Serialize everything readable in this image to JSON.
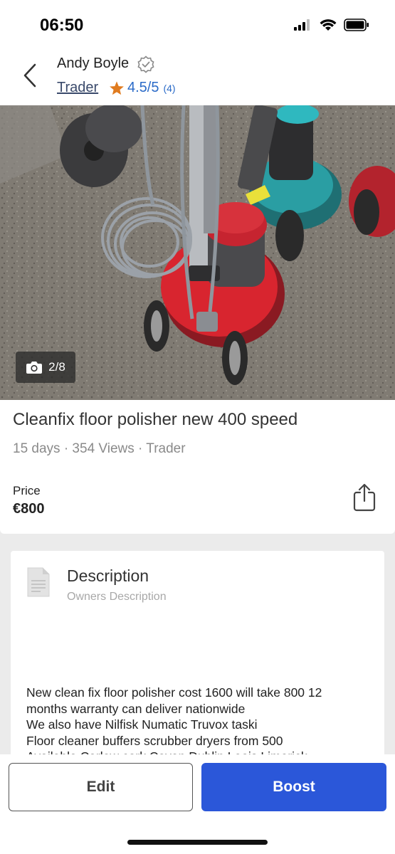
{
  "status_bar": {
    "time": "06:50"
  },
  "header": {
    "seller_name": "Andy Boyle",
    "seller_type": "Trader",
    "rating": "4.5/5",
    "rating_count": "(4)",
    "icons": [
      "back-chevron-icon",
      "verified-badge-icon",
      "star-icon"
    ]
  },
  "photo": {
    "counter": "2/8",
    "icon": "camera-icon"
  },
  "listing": {
    "title": "Cleanfix floor polisher new 400 speed",
    "meta": "15 days · 354 Views · Trader",
    "price_label": "Price",
    "price_value": "€800",
    "share_icon": "share-icon"
  },
  "description": {
    "heading": "Description",
    "subheading": "Owners Description",
    "lines": [
      "New clean fix floor polisher cost 1600 will take 800 12",
      "months warranty can deliver nationwide",
      "We also have Nilfisk Numatic Truvox taski",
      "Floor cleaner buffers scrubber dryers from 500",
      "Available Carlow cork Cavan Dublin Laois Limerick"
    ]
  },
  "actions": {
    "edit_label": "Edit",
    "boost_label": "Boost"
  },
  "colors": {
    "accent_blue": "#2b57d9",
    "rating_blue": "#2b6bc8",
    "star_orange": "#e07b1f"
  }
}
